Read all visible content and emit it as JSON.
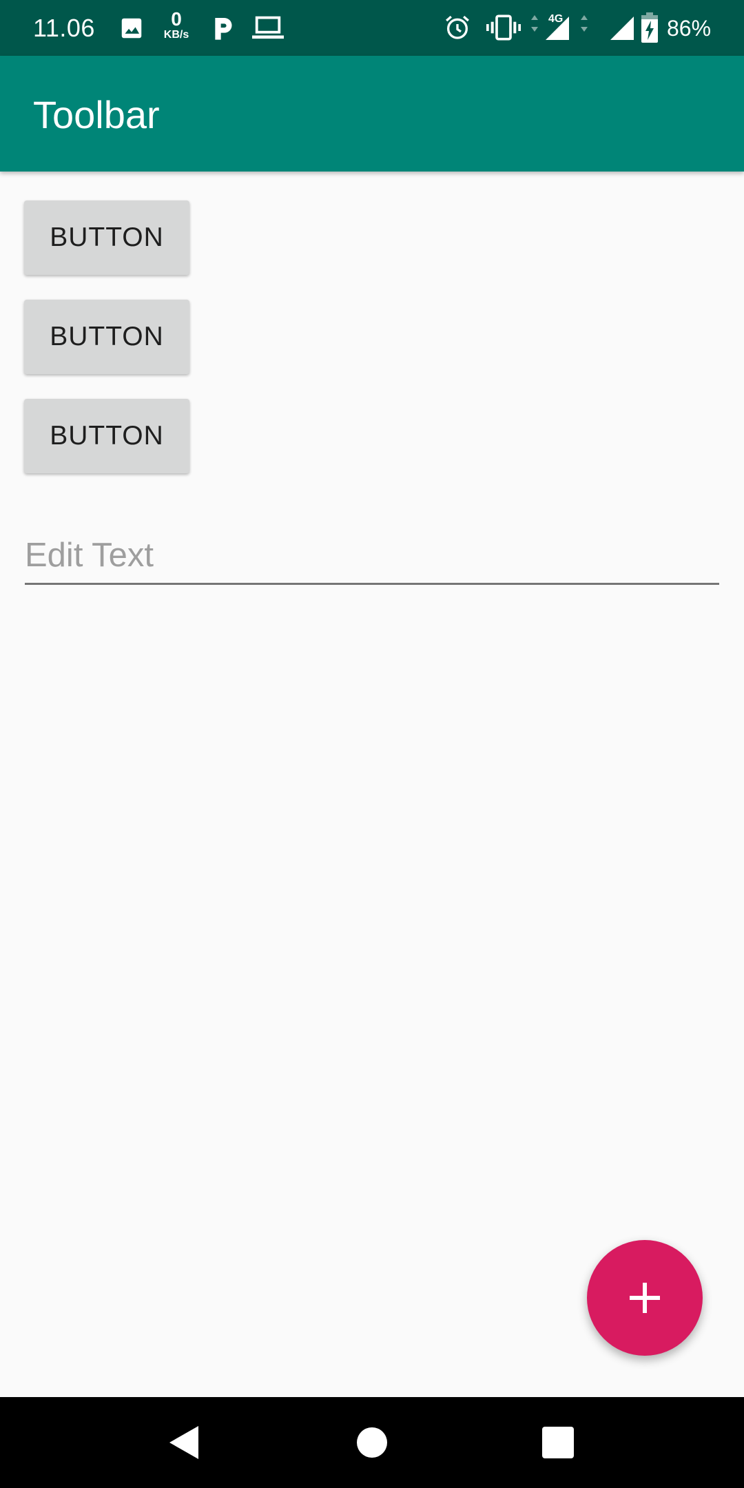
{
  "status_bar": {
    "time": "11.06",
    "net_speed_value": "0",
    "net_speed_unit": "KB/s",
    "battery_percent": "86%",
    "icons": [
      "image-icon",
      "parking-icon",
      "laptop-icon",
      "alarm-icon",
      "vibrate-icon",
      "signal-4g-icon",
      "signal-icon",
      "battery-charging-icon"
    ]
  },
  "toolbar": {
    "title": "Toolbar",
    "color": "#008577"
  },
  "buttons": [
    {
      "label": "BUTTON"
    },
    {
      "label": "BUTTON"
    },
    {
      "label": "BUTTON"
    }
  ],
  "edit_text": {
    "value": "",
    "placeholder": "Edit Text"
  },
  "fab": {
    "icon": "plus-icon",
    "color": "#d81b60"
  },
  "nav_bar": {
    "icons": [
      "back-icon",
      "home-icon",
      "recents-icon"
    ]
  }
}
